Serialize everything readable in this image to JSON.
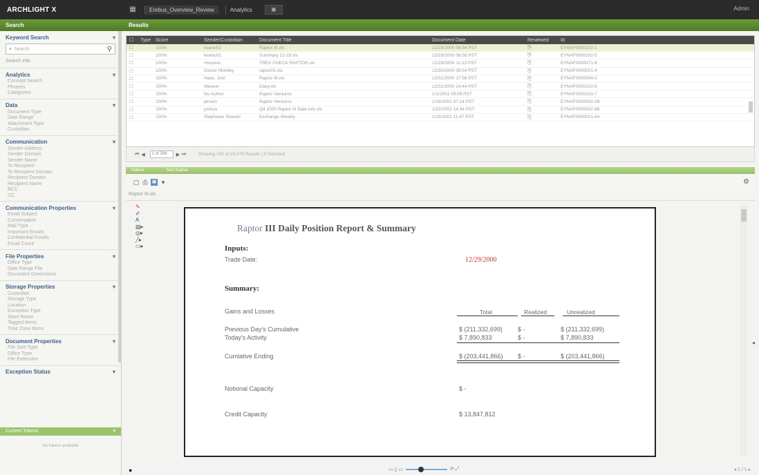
{
  "app": {
    "brand": "ARCHLIGHT X",
    "brand_sub": "",
    "tabs": [
      "Erebus_Overview_Review",
      "Analytics"
    ],
    "right": "Admin"
  },
  "green": {
    "left": "Search",
    "right": "Results"
  },
  "sidebar": {
    "keyword_title": "Keyword Search",
    "search_placeholder": "Search",
    "search_link": "Search Info",
    "sections": [
      {
        "title": "Analytics",
        "items": [
          "Concept Search",
          "Phrases",
          "Categories"
        ]
      },
      {
        "title": "Data",
        "items": [
          "Document Type",
          "Date Range",
          "Attachment Type",
          "Custodian"
        ]
      },
      {
        "title": "Communication",
        "items": [
          "Sender Address",
          "Sender Domain",
          "Sender Name",
          "To Recipient",
          "To Recipient Domain",
          "Recipient Domain",
          "Recipient Name",
          "BCC",
          "CC"
        ]
      },
      {
        "title": "Communication Properties",
        "items": [
          "Email Subject",
          "Conversation",
          "Mail Type",
          "Important Emails",
          "Confidential Emails",
          "Email Count"
        ]
      },
      {
        "title": "File Properties",
        "items": [
          "Office Type",
          "Date Range File",
          "Document Dimensions"
        ]
      },
      {
        "title": "Storage Properties",
        "items": [
          "Custodian",
          "Storage Type",
          "Location",
          "Exception Type",
          "Store Name",
          "Tagged Items",
          "Time Zone Items"
        ]
      },
      {
        "title": "Document Properties",
        "items": [
          "File Size Type",
          "Office Type",
          "File Extension"
        ]
      },
      {
        "title": "Exception Status",
        "items": []
      }
    ],
    "bottom_bar": "Current Tokens",
    "footer": "No tokens available"
  },
  "grid": {
    "headers": [
      "",
      "Type",
      "Score",
      "Sender/Custodian",
      "Document Title",
      "Document Date",
      "",
      "",
      "",
      "Reviewed",
      "Id",
      "",
      ""
    ],
    "rows": [
      {
        "score": "100%",
        "sender": "keanu02",
        "title": "Raptor III.xls",
        "date": "12/29/2000 08:54 PST",
        "id": "EYNAF0000102-1",
        "sel": true
      },
      {
        "score": "100%",
        "sender": "keanu02",
        "title": "Summary 12-29.xls",
        "date": "12/29/2000 08:58 PST",
        "id": "EYNAF0000102-5",
        "sel": false
      },
      {
        "score": "100%",
        "sender": "Houston",
        "title": "TREX CHECK RAPTOR.xls",
        "date": "12/29/2000 11:23 PST",
        "id": "EYNAF0000071-6",
        "sel": false
      },
      {
        "score": "100%",
        "sender": "Doctor Montley",
        "title": "raptor01.xls",
        "date": "12/30/2000 08:54 PST",
        "id": "EYNAF0000001-4",
        "sel": false
      },
      {
        "score": "100%",
        "sender": "Haas, Joel",
        "title": "Raptor III.xls",
        "date": "12/31/2000 17:56 PST",
        "id": "EYNAF0000004-0",
        "sel": false
      },
      {
        "score": "100%",
        "sender": "Weaver",
        "title": "Diary.xls",
        "date": "12/31/2000 14:44 PST",
        "id": "EYNAF0000102-8",
        "sel": false
      },
      {
        "score": "100%",
        "sender": "No Author",
        "title": "Raptor Ventures",
        "date": "1/1/2001 09:09 PST",
        "id": "EYNAF0000103-7",
        "sel": false
      },
      {
        "score": "100%",
        "sender": "jensen",
        "title": "Raptor Ventures",
        "date": "1/18/2001 07:14 PST",
        "id": "EYNAF0000002-08",
        "sel": false
      },
      {
        "score": "100%",
        "sender": "joshua",
        "title": "Q4 2000 Raptor III Date info.xls",
        "date": "1/22/2001 14:44 PST",
        "id": "EYNAF0000002-88",
        "sel": false
      },
      {
        "score": "100%",
        "sender": "Stephanie Stewart",
        "title": "Exchange Weekly",
        "date": "1/29/2001 11:47 PST",
        "id": "EYNAF0000001-44",
        "sel": false
      }
    ],
    "pager": {
      "page": "1 of 294",
      "msg": "Showing 100 of 29,479 Results | 0 Selected"
    }
  },
  "viewer": {
    "tab_native": "Native",
    "tab_text": "Text Native",
    "doc_name": "Raptor III.xls"
  },
  "doc": {
    "title_part1": "Raptor",
    "title_part2": " III Daily Position Report & Summary",
    "inputs": "Inputs:",
    "trade_date_label": "Trade Date:",
    "trade_date": "12/29/2000",
    "summary": "Summary:",
    "gains_label": "Gains and Losses",
    "col_total": "Total",
    "col_realized": "Realized",
    "col_unrealized": "Unrealized",
    "prev_label": "Previous Day's Cumulative",
    "prev_total": "$ (211,332,699)",
    "prev_real": "$       -",
    "prev_unreal": "$ (211,332,699)",
    "today_label": "Today's Activity",
    "today_total": "$     7,890,833",
    "today_real": "$       -",
    "today_unreal": "$     7,890,833",
    "cum_label": "Cumlative Ending",
    "cum_total": "$ (203,441,866)",
    "cum_real": "$       -",
    "cum_unreal": "$ (203,441,866)",
    "notional_label": "Notional Capacity",
    "notional_val": "$              -",
    "credit_label": "Credit Capacity",
    "credit_val": "$   13,847,812"
  },
  "bottom": {
    "page_nav": "1 / 1"
  }
}
